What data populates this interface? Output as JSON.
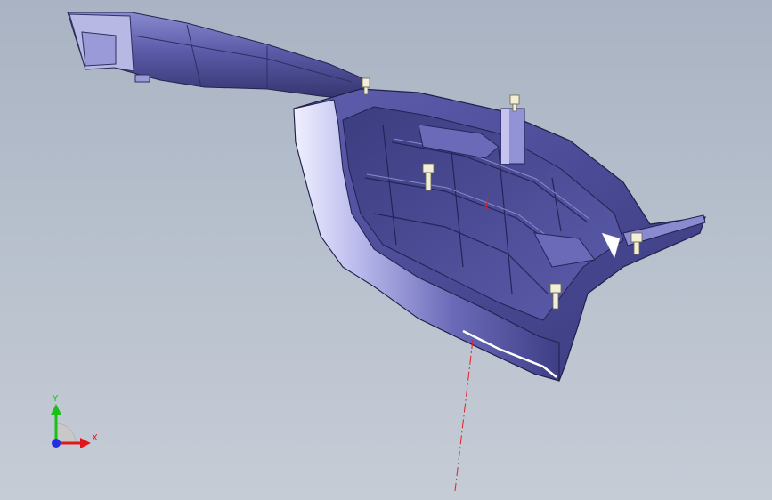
{
  "viewport": {
    "background_top": "#a9b3c3",
    "background_bottom": "#c6ccd6"
  },
  "model": {
    "part_color": "#50509a",
    "part_highlight": "#c8c8f0",
    "part_shadow": "#2a2a5e",
    "clip_color": "#f2efd6",
    "axis_line_color": "#e02020"
  },
  "axis_triad": {
    "x_label": "X",
    "y_label": "Y",
    "x_color": "#e01818",
    "y_color": "#18c018",
    "z_color": "#2030e0",
    "x_icon": "x-axis-arrow-icon",
    "y_icon": "y-axis-arrow-icon",
    "z_icon": "z-axis-dot-icon"
  }
}
